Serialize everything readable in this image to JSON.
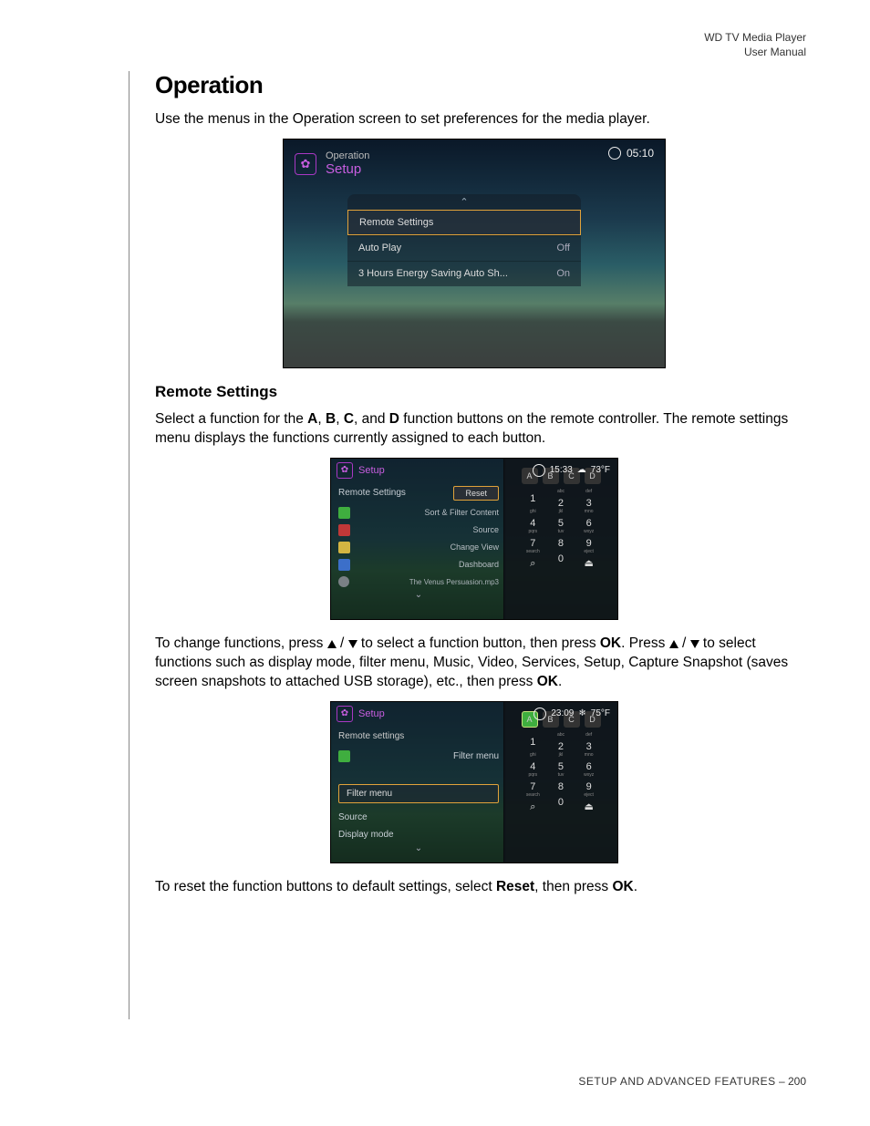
{
  "header": {
    "line1": "WD TV Media Player",
    "line2": "User Manual"
  },
  "section": {
    "title": "Operation",
    "intro": "Use the menus in the Operation screen to set preferences for the media player."
  },
  "shot1": {
    "breadcrumb": "Operation",
    "screenTitle": "Setup",
    "time": "05:10",
    "items": [
      {
        "label": "Remote Settings",
        "value": ""
      },
      {
        "label": "Auto Play",
        "value": "Off"
      },
      {
        "label": "3 Hours Energy Saving Auto Sh...",
        "value": "On"
      }
    ]
  },
  "remote": {
    "heading": "Remote Settings",
    "para1a": "Select a function for the ",
    "para1b": ", and ",
    "para1c": " function buttons on the remote controller. The remote settings menu displays the functions currently assigned to each button."
  },
  "shot2": {
    "screenTitle": "Setup",
    "header": "Remote Settings",
    "reset": "Reset",
    "rows": [
      {
        "key": "A",
        "label": "Sort & Filter Content"
      },
      {
        "key": "B",
        "label": "Source"
      },
      {
        "key": "C",
        "label": "Change View"
      },
      {
        "key": "D",
        "label": "Dashboard"
      }
    ],
    "nowPlaying": "The Venus Persuasion.mp3",
    "time": "15:33",
    "temp": "73°F",
    "keypad": {
      "abcd": [
        "A",
        "B",
        "C",
        "D"
      ],
      "cells": [
        {
          "sub": "",
          "n": "1"
        },
        {
          "sub": "abc",
          "n": "2"
        },
        {
          "sub": "def",
          "n": "3"
        },
        {
          "sub": "ghi",
          "n": "4"
        },
        {
          "sub": "jkl",
          "n": "5"
        },
        {
          "sub": "mno",
          "n": "6"
        },
        {
          "sub": "pqrs",
          "n": "7"
        },
        {
          "sub": "tuv",
          "n": "8"
        },
        {
          "sub": "wxyz",
          "n": "9"
        },
        {
          "sub": "search",
          "n": "⌕"
        },
        {
          "sub": "",
          "n": "0"
        },
        {
          "sub": "eject",
          "n": "⏏"
        }
      ]
    }
  },
  "para2": {
    "a": "To change functions, press ",
    "b": " to select a function button, then press ",
    "ok1": "OK",
    "c": ". Press ",
    "d": " to select functions such as display mode, filter menu, Music, Video, Services, Setup, Capture Snapshot (saves screen snapshots to attached USB storage), etc., then press ",
    "ok2": "OK",
    "e": "."
  },
  "shot3": {
    "screenTitle": "Setup",
    "header": "Remote settings",
    "currentKey": "A",
    "currentVal": "Filter menu",
    "selected": "Filter menu",
    "opt1": "Source",
    "opt2": "Display mode",
    "time": "23:09",
    "temp": "75°F",
    "keypad": {
      "abcd": [
        "A",
        "B",
        "C",
        "D"
      ],
      "cells": [
        {
          "sub": "",
          "n": "1"
        },
        {
          "sub": "abc",
          "n": "2"
        },
        {
          "sub": "def",
          "n": "3"
        },
        {
          "sub": "ghi",
          "n": "4"
        },
        {
          "sub": "jkl",
          "n": "5"
        },
        {
          "sub": "mno",
          "n": "6"
        },
        {
          "sub": "pqrs",
          "n": "7"
        },
        {
          "sub": "tuv",
          "n": "8"
        },
        {
          "sub": "wxyz",
          "n": "9"
        },
        {
          "sub": "search",
          "n": "⌕"
        },
        {
          "sub": "",
          "n": "0"
        },
        {
          "sub": "eject",
          "n": "⏏"
        }
      ]
    }
  },
  "para3": {
    "a": "To reset the function buttons to default settings, select ",
    "reset": "Reset",
    "b": ", then press ",
    "ok": "OK",
    "c": "."
  },
  "footer": {
    "section": "SETUP AND ADVANCED FEATURES",
    "page": "200"
  },
  "keys": {
    "A": "A",
    "B": "B",
    "C": "C",
    "D": "D"
  }
}
